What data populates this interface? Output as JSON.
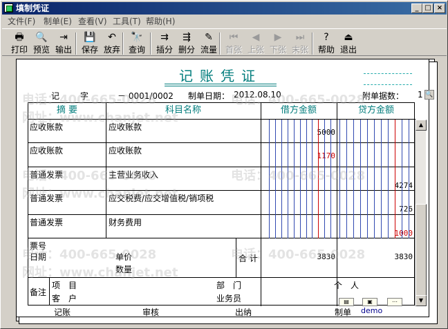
{
  "window": {
    "title": "填制凭证",
    "controls": [
      "_",
      "□",
      "×"
    ]
  },
  "menu": [
    "文件(F)",
    "制单(E)",
    "查看(V)",
    "工具(T)",
    "帮助(H)"
  ],
  "toolbar": [
    {
      "label": "打印",
      "icon": "printer-icon",
      "glyph": "🖶",
      "enabled": true
    },
    {
      "label": "预览",
      "icon": "preview-icon",
      "glyph": "🔍",
      "enabled": true
    },
    {
      "label": "输出",
      "icon": "export-icon",
      "glyph": "⇥",
      "enabled": true
    },
    {
      "label": "保存",
      "icon": "save-icon",
      "glyph": "💾",
      "enabled": true
    },
    {
      "label": "放弃",
      "icon": "undo-icon",
      "glyph": "↶",
      "enabled": true
    },
    {
      "label": "查询",
      "icon": "binoculars-icon",
      "glyph": "🔭",
      "enabled": true
    },
    {
      "label": "插分",
      "icon": "insert-line-icon",
      "glyph": "⇉",
      "enabled": true
    },
    {
      "label": "删分",
      "icon": "delete-line-icon",
      "glyph": "⇶",
      "enabled": true
    },
    {
      "label": "流量",
      "icon": "cashflow-icon",
      "glyph": "✎",
      "enabled": true
    },
    {
      "label": "首张",
      "icon": "first-page-icon",
      "glyph": "⏮",
      "enabled": false
    },
    {
      "label": "上张",
      "icon": "prev-page-icon",
      "glyph": "◀",
      "enabled": false
    },
    {
      "label": "下张",
      "icon": "next-page-icon",
      "glyph": "▶",
      "enabled": false
    },
    {
      "label": "末张",
      "icon": "last-page-icon",
      "glyph": "⏭",
      "enabled": false
    },
    {
      "label": "帮助",
      "icon": "help-icon",
      "glyph": "?",
      "enabled": true
    },
    {
      "label": "退出",
      "icon": "exit-icon",
      "glyph": "⏏",
      "enabled": true
    }
  ],
  "voucher": {
    "title": "记账凭证",
    "type_label": "记",
    "type_suffix": "字",
    "number": "－ 0001/0002",
    "date_label": "制单日期：",
    "date": "2012.08.10",
    "attach_label": "附单据数：",
    "attach_count": "1",
    "columns": {
      "summary": "摘 要",
      "account": "科目名称",
      "debit": "借方金额",
      "credit": "贷方金额"
    },
    "rows": [
      {
        "summary": "应收账款",
        "account": "应收账款",
        "debit": "5000",
        "debit_red": false,
        "credit": "",
        "credit_red": false
      },
      {
        "summary": "应收账款",
        "account": "应收账款",
        "debit": "1170",
        "debit_red": true,
        "credit": "",
        "credit_red": false
      },
      {
        "summary": "普通发票",
        "account": "主营业务收入",
        "debit": "",
        "debit_red": false,
        "credit": "4274",
        "credit_red": false
      },
      {
        "summary": "普通发票",
        "account": "应交税费/应交增值税/销项税",
        "debit": "",
        "debit_red": false,
        "credit": "726",
        "credit_red": false
      },
      {
        "summary": "普通发票",
        "account": "财务费用",
        "debit": "",
        "debit_red": false,
        "credit": "1000",
        "credit_red": true
      }
    ],
    "totals": {
      "ticket_label": "票号",
      "date_label": "日期",
      "price_label": "单价",
      "qty_label": "数量",
      "total_label": "合 计",
      "debit": "3830",
      "credit": "3830"
    },
    "memo": {
      "label": "备注",
      "project_label": "项　目",
      "customer_label": "客　户",
      "dept_label": "部　门",
      "sales_label": "业务员",
      "person_label": "个　人"
    },
    "signatures": {
      "bookkeep": "记账",
      "audit": "审核",
      "cashier": "出纳",
      "maker_label": "制单",
      "maker": "demo"
    }
  },
  "watermark": {
    "phone": "电话：400-665-0028",
    "site": "网址：www.chanjet.net"
  }
}
